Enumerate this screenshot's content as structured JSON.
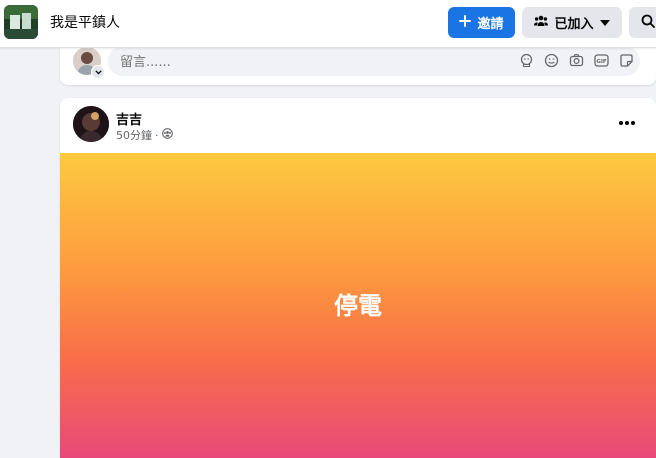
{
  "header": {
    "group_name": "我是平鎮人",
    "invite_label": "邀請",
    "joined_label": "已加入",
    "icons": {
      "invite": "plus-icon",
      "joined": "group-people-icon",
      "caret": "caret-down-icon",
      "search": "search-icon"
    }
  },
  "comment_box": {
    "placeholder": "留言......",
    "tools": [
      "avatar-sticker-icon",
      "emoji-icon",
      "camera-icon",
      "gif-icon",
      "sticker-icon"
    ]
  },
  "post": {
    "author": "吉吉",
    "time": "50分鐘",
    "separator": "·",
    "privacy_icon": "group-privacy-icon",
    "more_icon": "more-dots-icon",
    "text": "停電",
    "background_colors": [
      "#fdca40",
      "#fd9b3e",
      "#f86d4a",
      "#e9497a"
    ]
  },
  "colors": {
    "primary_button": "#1b74e4",
    "secondary_button": "#e4e6eb",
    "page_background": "#f0f2f5"
  }
}
